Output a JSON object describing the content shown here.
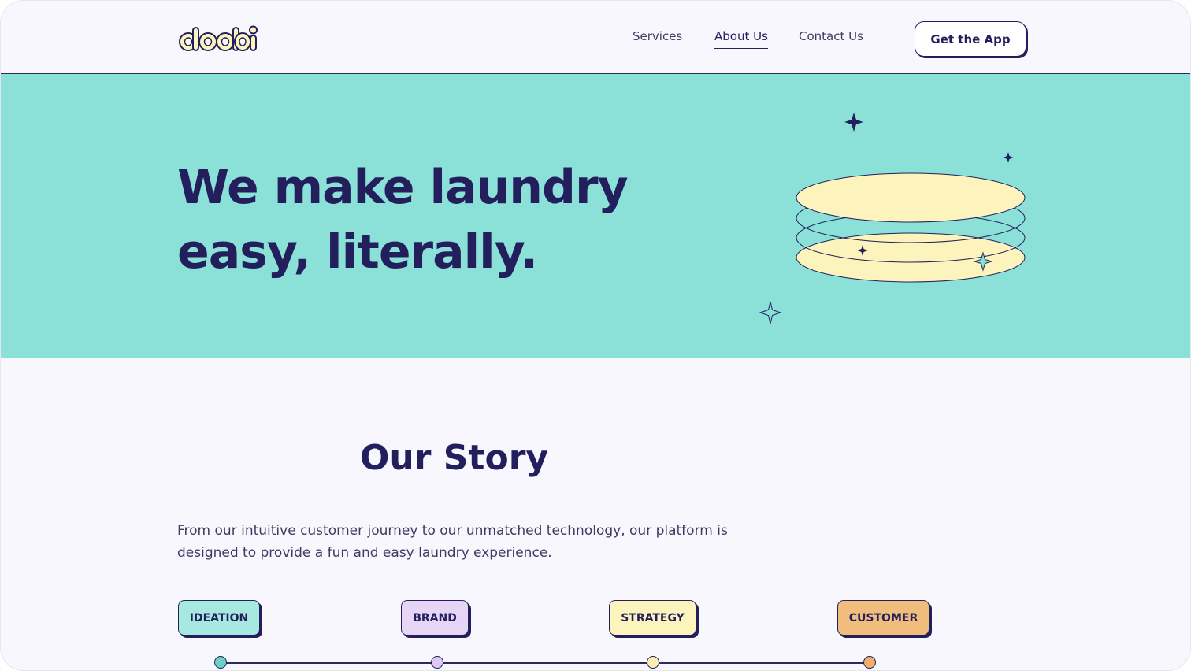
{
  "brand": {
    "logo_text": "doobi",
    "colors": {
      "navy": "#231f5c",
      "mint": "#8be1d7",
      "cream": "#fdf4bd",
      "lilac": "#e6d5f5",
      "peach": "#f0bd7c",
      "page_bg": "#f7f7fd"
    }
  },
  "nav": {
    "links": [
      {
        "label": "Services",
        "active": false
      },
      {
        "label": "About Us",
        "active": true
      },
      {
        "label": "Contact Us",
        "active": false
      }
    ],
    "cta_label": "Get the App"
  },
  "hero": {
    "title_line1": "We make laundry",
    "title_line2": "easy, literally."
  },
  "story": {
    "title": "Our Story",
    "text": "From our intuitive customer journey to our unmatched technology, our platform is designed to provide a fun and easy laundry experience.",
    "tags": [
      {
        "label": "IDEATION",
        "color": "#a7e9e1",
        "dot_color": "#6fd1c6"
      },
      {
        "label": "BRAND",
        "color": "#e6d5f5",
        "dot_color": "#dcc8f0"
      },
      {
        "label": "STRATEGY",
        "color": "#fdf4bd",
        "dot_color": "#fbeeb0"
      },
      {
        "label": "CUSTOMER",
        "color": "#f0bd7c",
        "dot_color": "#eeb06a"
      }
    ]
  }
}
